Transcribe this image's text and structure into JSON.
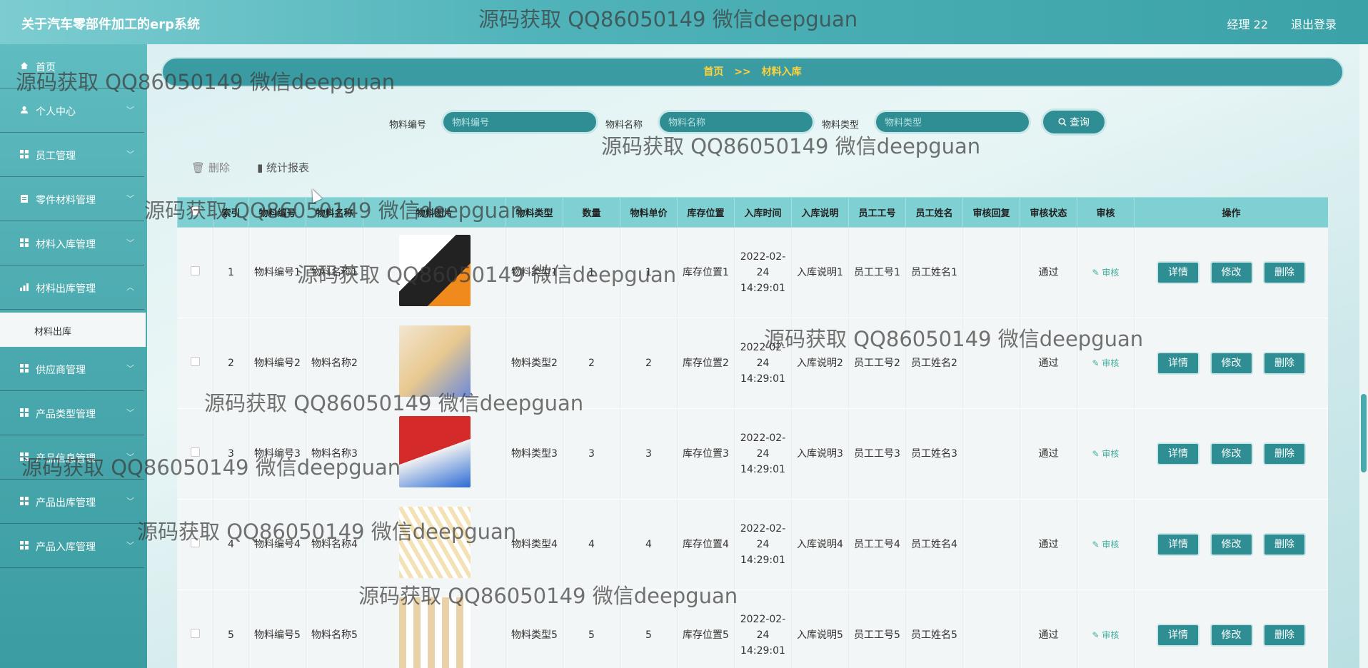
{
  "header": {
    "app_title": "关于汽车零部件加工的erp系统",
    "user": "经理 22",
    "logout": "退出登录"
  },
  "sidebar": {
    "items": [
      {
        "label": "首页",
        "icon": "home-icon"
      },
      {
        "label": "个人中心",
        "icon": "user-icon"
      },
      {
        "label": "员工管理",
        "icon": "grid-icon"
      },
      {
        "label": "零件材料管理",
        "icon": "clipboard-icon"
      },
      {
        "label": "材料入库管理",
        "icon": "grid-icon"
      },
      {
        "label": "材料出库管理",
        "icon": "chart-icon"
      },
      {
        "label": "供应商管理",
        "icon": "grid-icon"
      },
      {
        "label": "产品类型管理",
        "icon": "grid-icon"
      },
      {
        "label": "产品信息管理",
        "icon": "grid-icon"
      },
      {
        "label": "产品出库管理",
        "icon": "grid-icon"
      },
      {
        "label": "产品入库管理",
        "icon": "grid-icon"
      }
    ],
    "submenu": "材料出库"
  },
  "breadcrumb": {
    "home": "首页",
    "sep": ">>",
    "current": "材料入库"
  },
  "search": {
    "code_label": "物料编号",
    "code_placeholder": "物料编号",
    "name_label": "物料名称",
    "name_placeholder": "物料名称",
    "type_label": "物料类型",
    "type_placeholder": "物料类型",
    "query": "查询"
  },
  "toolbar": {
    "delete": "删除",
    "stats": "统计报表"
  },
  "table": {
    "headers": [
      "",
      "索引",
      "物料编号",
      "物料名称",
      "物料图片",
      "物料类型",
      "数量",
      "物料单价",
      "库存位置",
      "入库时间",
      "入库说明",
      "员工工号",
      "员工姓名",
      "审核回复",
      "审核状态",
      "审核",
      "操作"
    ],
    "rows": [
      {
        "idx": "1",
        "code": "物料编号1",
        "name": "物料名称1",
        "type": "物料类型1",
        "qty": "1",
        "price": "1",
        "loc": "库存位置1",
        "time": "2022-02-24 14:29:01",
        "desc": "入库说明1",
        "emp_no": "员工工号1",
        "emp_name": "员工姓名1",
        "reply": "",
        "status": "通过",
        "audit": "审核"
      },
      {
        "idx": "2",
        "code": "物料编号2",
        "name": "物料名称2",
        "type": "物料类型2",
        "qty": "2",
        "price": "2",
        "loc": "库存位置2",
        "time": "2022-02-24 14:29:01",
        "desc": "入库说明2",
        "emp_no": "员工工号2",
        "emp_name": "员工姓名2",
        "reply": "",
        "status": "通过",
        "audit": "审核"
      },
      {
        "idx": "3",
        "code": "物料编号3",
        "name": "物料名称3",
        "type": "物料类型3",
        "qty": "3",
        "price": "3",
        "loc": "库存位置3",
        "time": "2022-02-24 14:29:01",
        "desc": "入库说明3",
        "emp_no": "员工工号3",
        "emp_name": "员工姓名3",
        "reply": "",
        "status": "通过",
        "audit": "审核"
      },
      {
        "idx": "4",
        "code": "物料编号4",
        "name": "物料名称4",
        "type": "物料类型4",
        "qty": "4",
        "price": "4",
        "loc": "库存位置4",
        "time": "2022-02-24 14:29:01",
        "desc": "入库说明4",
        "emp_no": "员工工号4",
        "emp_name": "员工姓名4",
        "reply": "",
        "status": "通过",
        "audit": "审核"
      },
      {
        "idx": "5",
        "code": "物料编号5",
        "name": "物料名称5",
        "type": "物料类型5",
        "qty": "5",
        "price": "5",
        "loc": "库存位置5",
        "time": "2022-02-24 14:29:01",
        "desc": "入库说明5",
        "emp_no": "员工工号5",
        "emp_name": "员工姓名5",
        "reply": "",
        "status": "通过",
        "audit": "审核"
      }
    ],
    "actions": {
      "detail": "详情",
      "edit": "修改",
      "delete": "删除"
    }
  },
  "watermark": "源码获取 QQ86050149 微信deepguan",
  "colors": {
    "accent": "#2f8e93",
    "header": "#4fb3b9",
    "breadcrumb_text": "#ffd23c",
    "table_header": "#7fd0d3"
  }
}
